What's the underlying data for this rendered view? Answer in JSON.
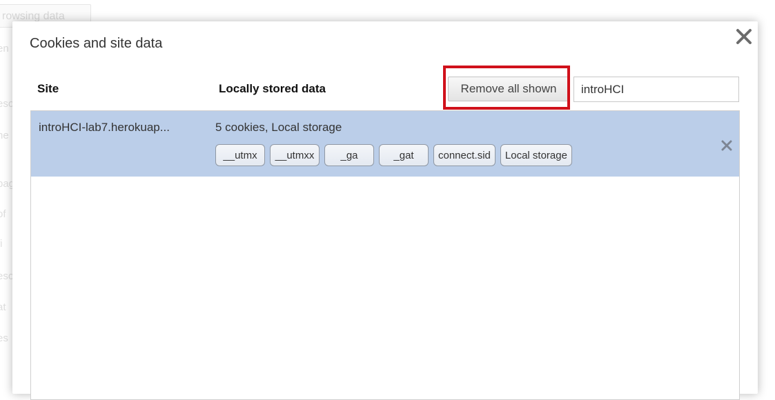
{
  "background": {
    "button_label": "rowsing data",
    "fragments": [
      "en",
      "eso",
      "ne",
      "pag",
      "of",
      "fi",
      "eso",
      "at",
      "es"
    ]
  },
  "dialog": {
    "title": "Cookies and site data",
    "close_icon": "close-icon",
    "headers": {
      "site": "Site",
      "local": "Locally stored data"
    },
    "remove_all_label": "Remove all shown",
    "search": {
      "value": "introHCI",
      "placeholder": ""
    },
    "highlight_color": "#d0111b"
  },
  "sites": [
    {
      "name": "introHCI-lab7.herokuap...",
      "summary": "5 cookies, Local storage",
      "items": [
        "__utmx",
        "__utmxx",
        "_ga",
        "_gat",
        "connect.sid",
        "Local storage"
      ],
      "selected_color": "#bbcee9",
      "remove_icon": "close-icon"
    }
  ]
}
